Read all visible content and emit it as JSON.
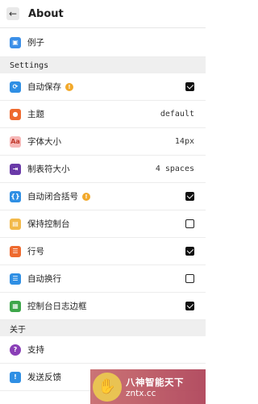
{
  "header": {
    "back_icon": "arrow-left-icon",
    "title": "About"
  },
  "top_item": {
    "label": "例子",
    "icon": "example-icon",
    "color": "#3b8fe8"
  },
  "sections": {
    "settings": "Settings",
    "about": "关于"
  },
  "settings": [
    {
      "label": "自动保存",
      "icon": "sync-icon",
      "color": "#2f8fe4",
      "info": true,
      "control": "checkbox",
      "checked": true
    },
    {
      "label": "主题",
      "icon": "palette-icon",
      "color": "#ee6a2f",
      "value": "default"
    },
    {
      "label": "字体大小",
      "icon": "font-size-icon",
      "color": "#f6b7b7",
      "icon_text": "Aa",
      "value": "14px"
    },
    {
      "label": "制表符大小",
      "icon": "tab-icon",
      "color": "#6a3aa8",
      "value": "4 spaces"
    },
    {
      "label": "自动闭合括号",
      "icon": "braces-icon",
      "color": "#2f8fe4",
      "info": true,
      "control": "checkbox",
      "checked": true
    },
    {
      "label": "保持控制台",
      "icon": "console-icon",
      "color": "#f2b94a",
      "control": "checkbox",
      "checked": false
    },
    {
      "label": "行号",
      "icon": "line-numbers-icon",
      "color": "#ee6a2f",
      "control": "checkbox",
      "checked": true
    },
    {
      "label": "自动换行",
      "icon": "wrap-icon",
      "color": "#2f8fe4",
      "control": "checkbox",
      "checked": false
    },
    {
      "label": "控制台日志边框",
      "icon": "console-border-icon",
      "color": "#3da64a",
      "control": "checkbox",
      "checked": true
    }
  ],
  "about": [
    {
      "label": "支持",
      "icon": "support-icon",
      "color": "#8a3fb7"
    },
    {
      "label": "发送反馈",
      "icon": "feedback-icon",
      "color": "#2f8fe4"
    }
  ],
  "watermark": {
    "line1": "八神智能天下",
    "line2": "zntx.cc"
  }
}
